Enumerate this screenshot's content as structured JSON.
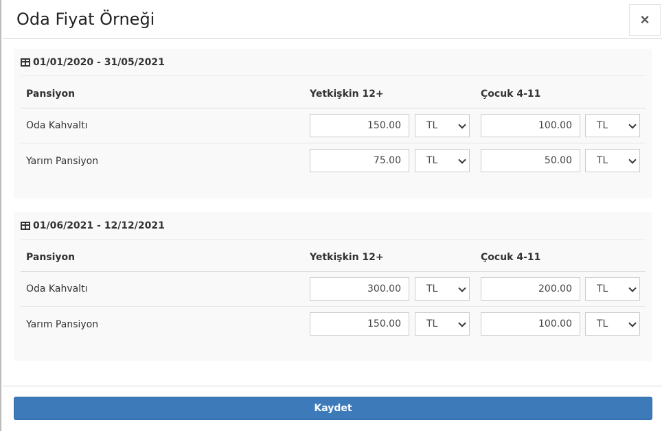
{
  "modal": {
    "title": "Oda Fiyat Örneği",
    "close_label": "×",
    "save_label": "Kaydet"
  },
  "periods": [
    {
      "range": "01/01/2020 - 31/05/2021",
      "headers": {
        "board": "Pansiyon",
        "adult": "Yetkişkin 12+",
        "child": "Çocuk 4-11"
      },
      "rows": [
        {
          "board": "Oda Kahvaltı",
          "adult_price": "150.00",
          "adult_currency": "TL",
          "child_price": "100.00",
          "child_currency": "TL"
        },
        {
          "board": "Yarım Pansiyon",
          "adult_price": "75.00",
          "adult_currency": "TL",
          "child_price": "50.00",
          "child_currency": "TL"
        }
      ]
    },
    {
      "range": "01/06/2021 - 12/12/2021",
      "headers": {
        "board": "Pansiyon",
        "adult": "Yetkişkin 12+",
        "child": "Çocuk 4-11"
      },
      "rows": [
        {
          "board": "Oda Kahvaltı",
          "adult_price": "300.00",
          "adult_currency": "TL",
          "child_price": "200.00",
          "child_currency": "TL"
        },
        {
          "board": "Yarım Pansiyon",
          "adult_price": "150.00",
          "adult_currency": "TL",
          "child_price": "100.00",
          "child_currency": "TL"
        }
      ]
    }
  ],
  "icons": {
    "period": "calendar-table-icon",
    "close": "close-icon",
    "select": "chevron-down-icon"
  }
}
